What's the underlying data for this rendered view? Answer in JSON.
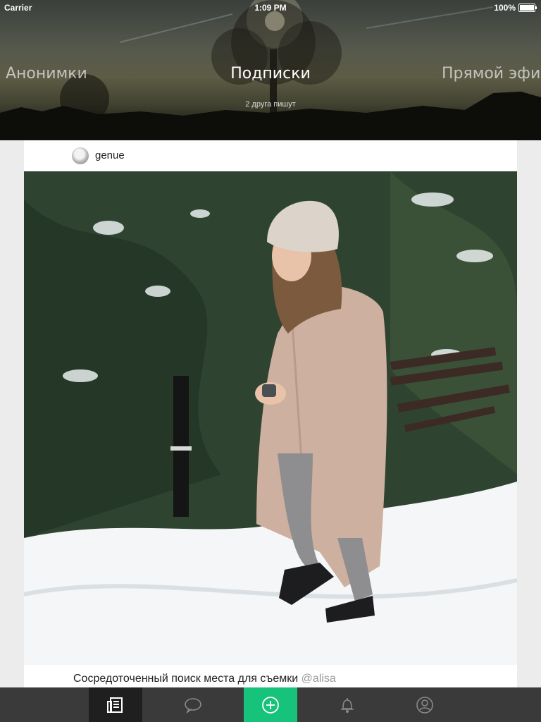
{
  "status_bar": {
    "carrier": "Carrier",
    "time": "1:09 PM",
    "battery": "100%"
  },
  "header": {
    "tabs": [
      "Анонимки",
      "Подписки",
      "Прямой эфи"
    ],
    "active_tab": "Подписки",
    "subtitle": "2 друга пишут"
  },
  "post": {
    "username": "genue",
    "caption": "Сосредоточенный поиск места для съемки",
    "mention": "@alisa"
  },
  "tab_bar": {
    "items": [
      "feed-icon",
      "chat-bubble-icon",
      "add-circle-icon",
      "bell-icon",
      "profile-icon"
    ],
    "active_index": 0,
    "accent": "#17c27b"
  }
}
